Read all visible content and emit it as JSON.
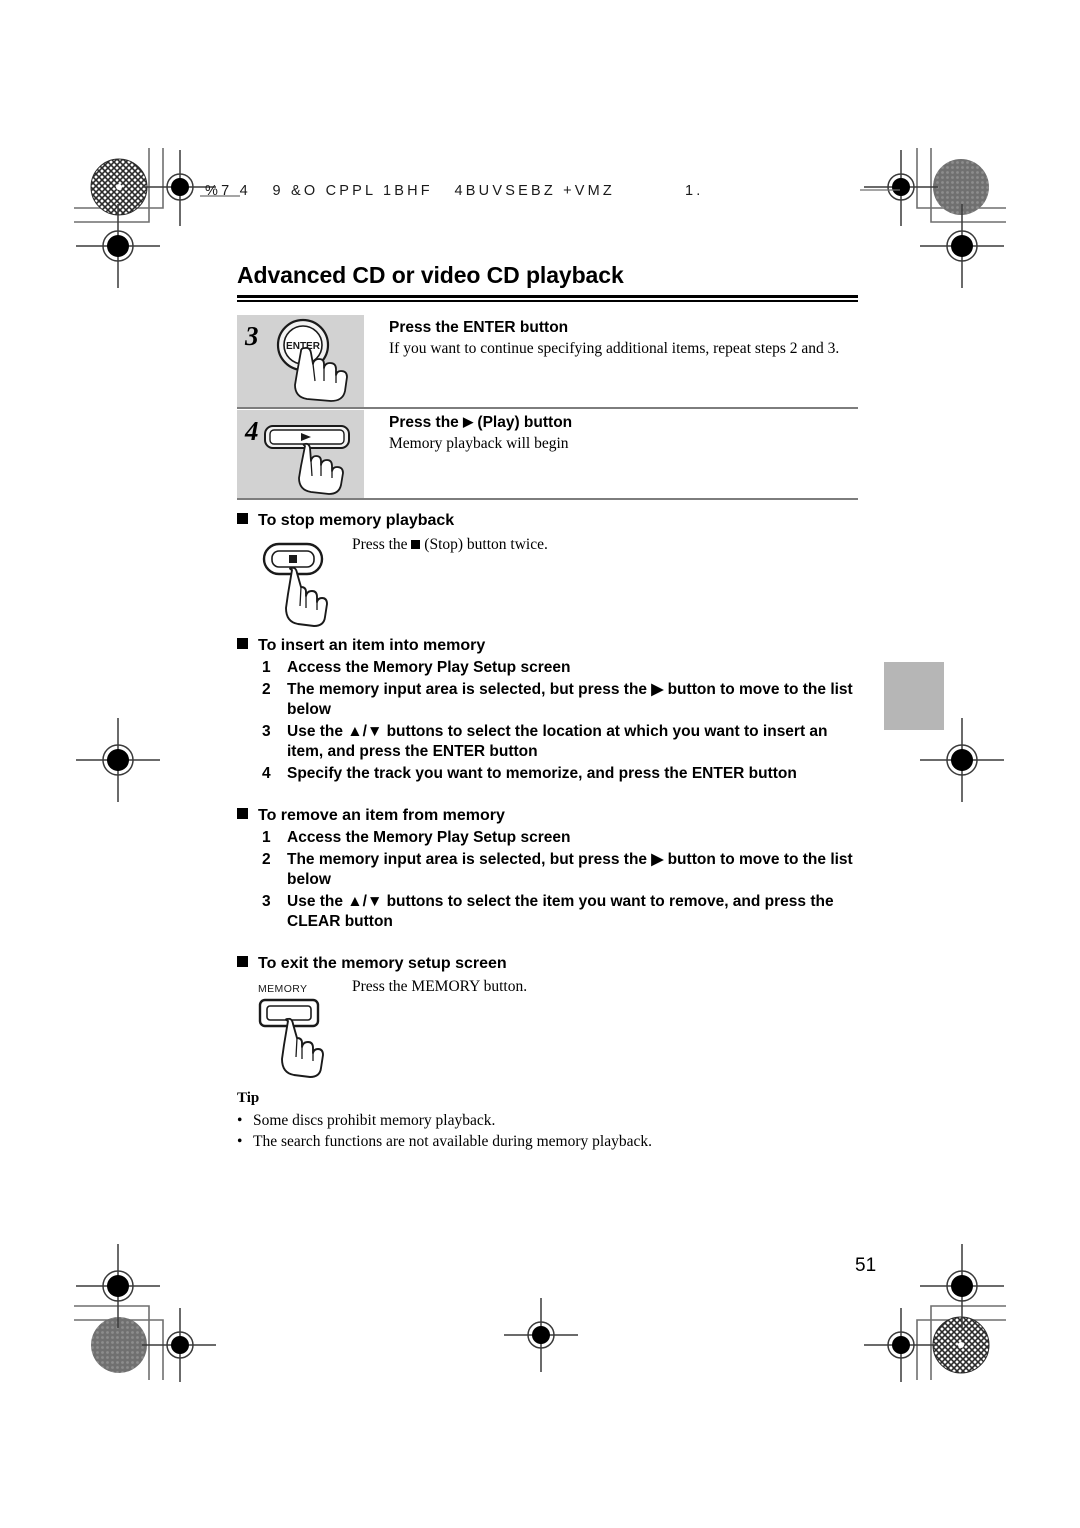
{
  "document": {
    "running_head": "%7 4   9 &O CPPL 1BHF   4BUVSEBZ +VMZ",
    "running_head_page": "1.",
    "page_number": "51",
    "title": "Advanced CD or video CD playback"
  },
  "steps": [
    {
      "number": "3",
      "button_icon": "enter-button-icon",
      "button_label": "ENTER",
      "heading": "Press the ENTER button",
      "text": "If you want to continue specifying additional items, repeat steps 2 and 3."
    },
    {
      "number": "4",
      "button_icon": "play-button-icon",
      "button_label": "",
      "heading_prefix": "Press the ",
      "heading_glyph": "▶",
      "heading_suffix": " (Play) button",
      "text": "Memory playback will begin"
    }
  ],
  "sections": [
    {
      "id": "stop-memory-playback",
      "heading": "To stop memory playback",
      "note_prefix": "Press the ",
      "note_suffix": " (Stop) button twice.",
      "icon": "stop-button-icon"
    },
    {
      "id": "insert-item-into-memory",
      "heading": "To insert an item into memory",
      "items": [
        {
          "n": "1",
          "text": "Access the Memory Play Setup screen"
        },
        {
          "n": "2",
          "text": "The memory input area is selected, but press the ▶ button to move to the list below"
        },
        {
          "n": "3",
          "text": "Use the ▲/▼ buttons to select the location at which you want to insert an item, and press the ENTER button"
        },
        {
          "n": "4",
          "text": "Specify the track you want to memorize, and press the ENTER button"
        }
      ]
    },
    {
      "id": "remove-item-from-memory",
      "heading": "To remove an item from memory",
      "items": [
        {
          "n": "1",
          "text": "Access the Memory Play Setup screen"
        },
        {
          "n": "2",
          "text": "The memory input area is selected, but press the ▶ button to move to the list below"
        },
        {
          "n": "3",
          "text": "Use the ▲/▼ buttons to select the item you want to remove, and press the CLEAR button"
        }
      ]
    },
    {
      "id": "exit-memory-setup-screen",
      "heading": "To exit the memory setup screen",
      "note": "Press the MEMORY button.",
      "icon": "memory-button-icon",
      "icon_label": "MEMORY"
    }
  ],
  "tip": {
    "heading": "Tip",
    "items": [
      "Some discs prohibit memory playback.",
      "The search functions are not available during memory playback."
    ]
  },
  "colors": {
    "panel_gray": "#d2d2d2",
    "tab_gray": "#b6b6b6",
    "rule": "#7d7d7d"
  }
}
